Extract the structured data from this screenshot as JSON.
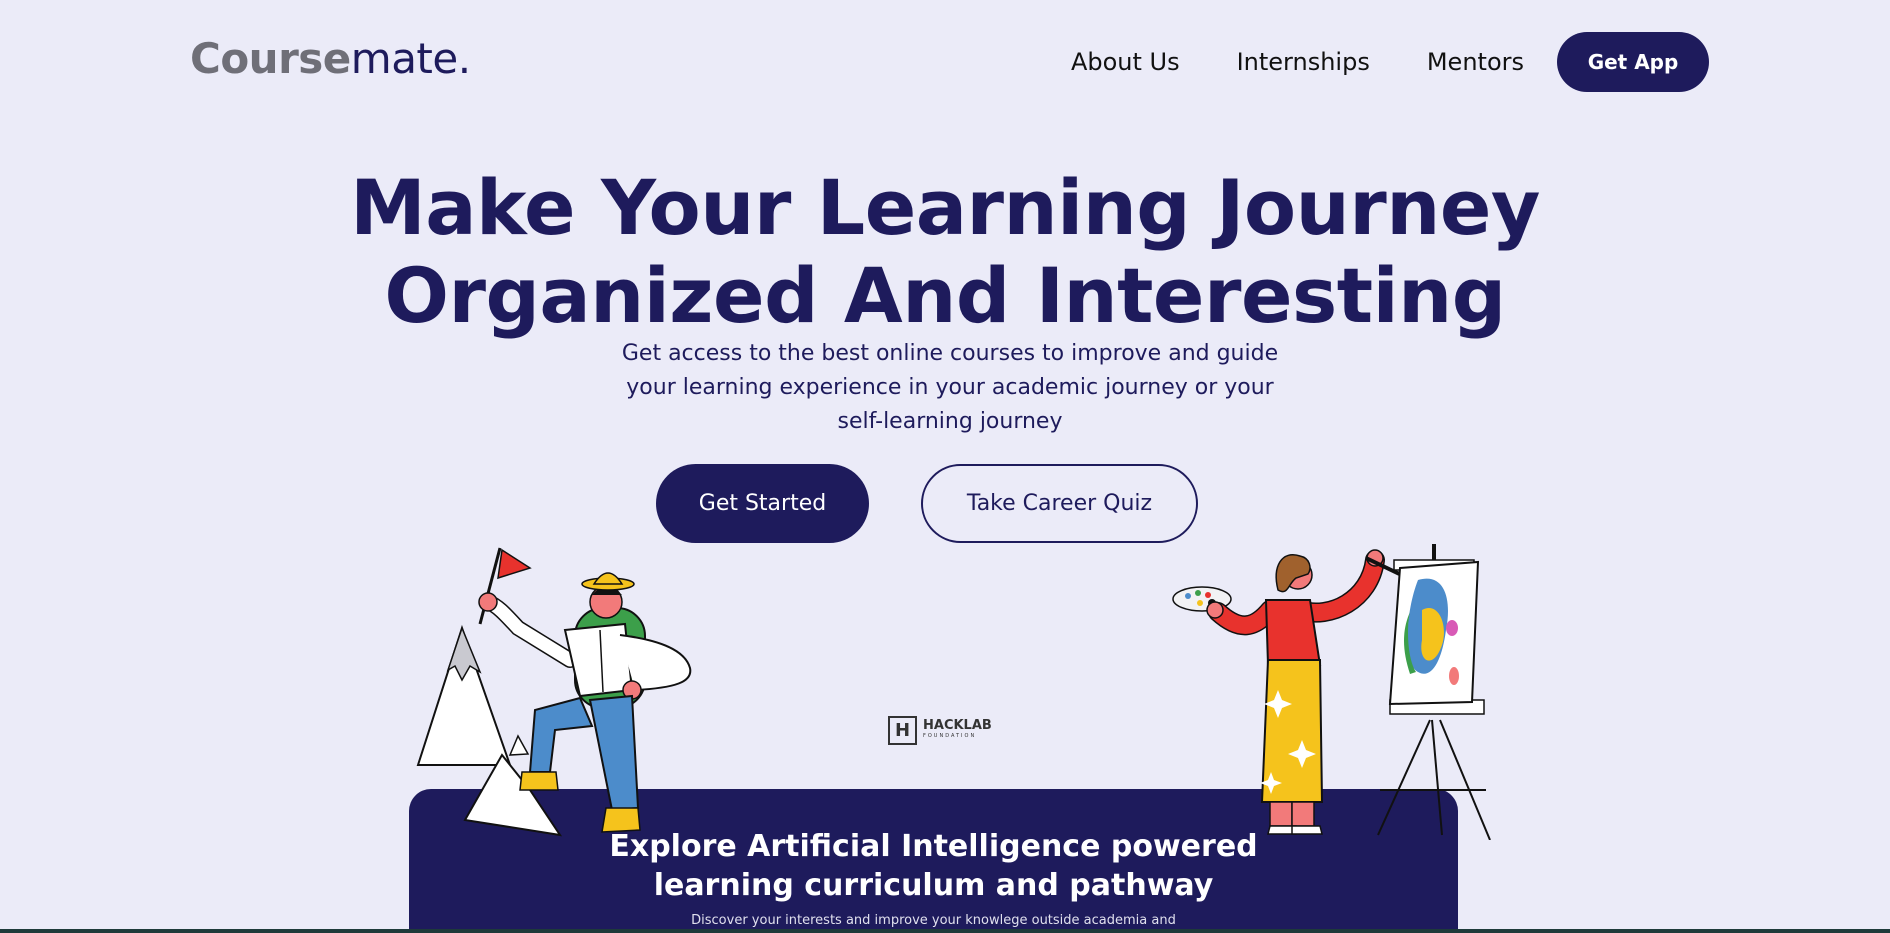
{
  "header": {
    "logo_part1": "Course",
    "logo_part2": "mate.",
    "nav": [
      "About Us",
      "Internships",
      "Mentors"
    ],
    "get_app": "Get App"
  },
  "hero": {
    "title_line1": "Make Your Learning Journey",
    "title_line2": "Organized And Interesting",
    "subtitle_line1": "Get access to the best online courses to improve and guide",
    "subtitle_line2": "your learning experience in your academic journey or your",
    "subtitle_line3": "self-learning journey",
    "cta_primary": "Get Started",
    "cta_secondary": "Take Career Quiz"
  },
  "partner": {
    "mark": "H",
    "name": "HACKLAB",
    "sub": "FOUNDATION"
  },
  "banner": {
    "title_line1": "Explore Artificial Intelligence powered",
    "title_line2": "learning curriculum and pathway",
    "text": "Discover your interests and improve your knowlege outside academia and"
  },
  "colors": {
    "background": "#ebebf8",
    "primary": "#1e1b5c",
    "logo_gray": "#6f6f78"
  },
  "icons": [
    "hiker-illustration",
    "mountain-illustration",
    "painter-illustration",
    "easel-illustration"
  ]
}
